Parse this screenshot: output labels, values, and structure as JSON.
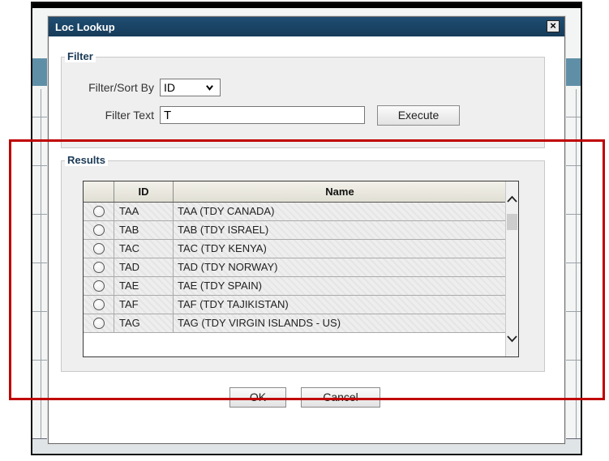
{
  "dialog": {
    "title": "Loc Lookup",
    "close_label": "×"
  },
  "filter": {
    "legend": "Filter",
    "sort_label": "Filter/Sort By",
    "sort_value": "ID",
    "text_label": "Filter Text",
    "text_value": "T",
    "execute_label": "Execute"
  },
  "results": {
    "legend": "Results",
    "columns": [
      "ID",
      "Name"
    ],
    "rows": [
      {
        "id": "TAA",
        "name": "TAA (TDY CANADA)"
      },
      {
        "id": "TAB",
        "name": "TAB (TDY ISRAEL)"
      },
      {
        "id": "TAC",
        "name": "TAC (TDY KENYA)"
      },
      {
        "id": "TAD",
        "name": "TAD (TDY NORWAY)"
      },
      {
        "id": "TAE",
        "name": "TAE (TDY SPAIN)"
      },
      {
        "id": "TAF",
        "name": "TAF (TDY TAJIKISTAN)"
      },
      {
        "id": "TAG",
        "name": "TAG (TDY VIRGIN ISLANDS - US)"
      }
    ]
  },
  "footer": {
    "ok_label": "OK",
    "cancel_label": "Cancel"
  },
  "colors": {
    "titlebar": "#1f4d72",
    "highlight": "#c00000",
    "background_band": "#5f8fa6"
  }
}
